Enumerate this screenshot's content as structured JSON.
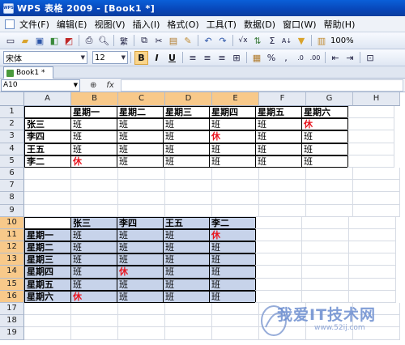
{
  "window": {
    "app_label": "WPS",
    "title": "WPS 表格 2009 - [Book1 *]"
  },
  "menu": [
    "文件(F)",
    "编辑(E)",
    "视图(V)",
    "插入(I)",
    "格式(O)",
    "工具(T)",
    "数据(D)",
    "窗口(W)",
    "帮助(H)"
  ],
  "toolbar": {
    "zoom": "100%"
  },
  "format": {
    "font_name": "宋体",
    "font_size": "12",
    "bold": "B",
    "italic": "I",
    "underline": "U"
  },
  "tab": {
    "label": "Book1 *"
  },
  "formula": {
    "cell_ref": "A10",
    "fx": "fx"
  },
  "columns": [
    "A",
    "B",
    "C",
    "D",
    "E",
    "F",
    "G",
    "H"
  ],
  "rows": [
    {
      "num": "1",
      "cells": [
        "",
        "星期一",
        "星期二",
        "星期三",
        "星期四",
        "星期五",
        "星期六",
        ""
      ]
    },
    {
      "num": "2",
      "cells": [
        "张三",
        "班",
        "班",
        "班",
        "班",
        "班",
        "休",
        ""
      ]
    },
    {
      "num": "3",
      "cells": [
        "李四",
        "班",
        "班",
        "班",
        "休",
        "班",
        "班",
        ""
      ]
    },
    {
      "num": "4",
      "cells": [
        "王五",
        "班",
        "班",
        "班",
        "班",
        "班",
        "班",
        ""
      ]
    },
    {
      "num": "5",
      "cells": [
        "李二",
        "休",
        "班",
        "班",
        "班",
        "班",
        "班",
        ""
      ]
    },
    {
      "num": "6",
      "cells": [
        "",
        "",
        "",
        "",
        "",
        "",
        "",
        ""
      ]
    },
    {
      "num": "7",
      "cells": [
        "",
        "",
        "",
        "",
        "",
        "",
        "",
        ""
      ]
    },
    {
      "num": "8",
      "cells": [
        "",
        "",
        "",
        "",
        "",
        "",
        "",
        ""
      ]
    },
    {
      "num": "9",
      "cells": [
        "",
        "",
        "",
        "",
        "",
        "",
        "",
        ""
      ]
    },
    {
      "num": "10",
      "cells": [
        "",
        "张三",
        "李四",
        "王五",
        "李二",
        "",
        "",
        ""
      ]
    },
    {
      "num": "11",
      "cells": [
        "星期一",
        "班",
        "班",
        "班",
        "休",
        "",
        "",
        ""
      ]
    },
    {
      "num": "12",
      "cells": [
        "星期二",
        "班",
        "班",
        "班",
        "班",
        "",
        "",
        ""
      ]
    },
    {
      "num": "13",
      "cells": [
        "星期三",
        "班",
        "班",
        "班",
        "班",
        "",
        "",
        ""
      ]
    },
    {
      "num": "14",
      "cells": [
        "星期四",
        "班",
        "休",
        "班",
        "班",
        "",
        "",
        ""
      ]
    },
    {
      "num": "15",
      "cells": [
        "星期五",
        "班",
        "班",
        "班",
        "班",
        "",
        "",
        ""
      ]
    },
    {
      "num": "16",
      "cells": [
        "星期六",
        "休",
        "班",
        "班",
        "班",
        "",
        "",
        ""
      ]
    },
    {
      "num": "17",
      "cells": [
        "",
        "",
        "",
        "",
        "",
        "",
        "",
        ""
      ]
    },
    {
      "num": "18",
      "cells": [
        "",
        "",
        "",
        "",
        "",
        "",
        "",
        ""
      ]
    },
    {
      "num": "19",
      "cells": [
        "",
        "",
        "",
        "",
        "",
        "",
        "",
        ""
      ]
    }
  ],
  "rest_marker": "休",
  "watermark": {
    "text": "我爱IT技术网",
    "url": "www.52ij.com"
  }
}
